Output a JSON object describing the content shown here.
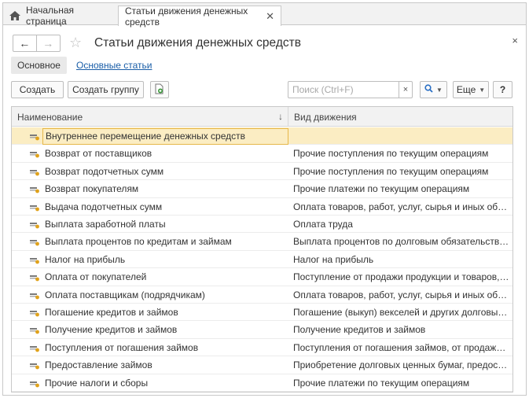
{
  "tabs": [
    {
      "label": "Начальная страница",
      "icon": "home-icon"
    },
    {
      "label": "Статьи движения денежных средств",
      "icon": "close-icon"
    }
  ],
  "header": {
    "title": "Статьи движения денежных средств",
    "nav_back": "←",
    "nav_forward": "→",
    "favorite_icon": "☆",
    "close": "×"
  },
  "sections": {
    "main": "Основное",
    "link": "Основные статьи"
  },
  "toolbar": {
    "create": "Создать",
    "create_group": "Создать группу",
    "search_placeholder": "Поиск (Ctrl+F)",
    "search_clear": "×",
    "more": "Еще",
    "help": "?"
  },
  "table": {
    "columns": {
      "name": "Наименование",
      "kind": "Вид движения",
      "sort": "↓"
    },
    "rows": [
      {
        "name": "Внутреннее перемещение денежных средств",
        "kind": ""
      },
      {
        "name": "Возврат от поставщиков",
        "kind": "Прочие поступления по текущим операциям"
      },
      {
        "name": "Возврат подотчетных сумм",
        "kind": "Прочие поступления по текущим операциям"
      },
      {
        "name": "Возврат покупателям",
        "kind": "Прочие платежи по текущим операциям"
      },
      {
        "name": "Выдача подотчетных сумм",
        "kind": "Оплата товаров, работ, услуг, сырья и иных оборотных активов"
      },
      {
        "name": "Выплата заработной платы",
        "kind": "Оплата труда"
      },
      {
        "name": "Выплата процентов по кредитам и займам",
        "kind": "Выплата процентов по долговым обязательствам"
      },
      {
        "name": "Налог на прибыль",
        "kind": "Налог на прибыль"
      },
      {
        "name": "Оплата от покупателей",
        "kind": "Поступление от продажи продукции и товаров, выполнения работ"
      },
      {
        "name": "Оплата поставщикам (подрядчикам)",
        "kind": "Оплата товаров, работ, услуг, сырья и иных оборотных активов"
      },
      {
        "name": "Погашение кредитов и займов",
        "kind": "Погашение (выкуп) векселей и других долговых ценных бумаг"
      },
      {
        "name": "Получение кредитов и займов",
        "kind": "Получение кредитов и займов"
      },
      {
        "name": "Поступления от погашения займов",
        "kind": "Поступления от погашения займов, от продажи долговых ценных бумаг"
      },
      {
        "name": "Предоставление займов",
        "kind": "Приобретение долговых ценных бумаг, предоставление займов"
      },
      {
        "name": "Прочие налоги и сборы",
        "kind": "Прочие платежи по текущим операциям"
      }
    ],
    "selected_index": 0
  },
  "colors": {
    "accent_link": "#1a5ea8",
    "selected_row": "#fbedc3",
    "selected_border": "#e6b84a",
    "search_icon": "#2a6fc4",
    "create_group_icon": "#3c9a3c"
  }
}
